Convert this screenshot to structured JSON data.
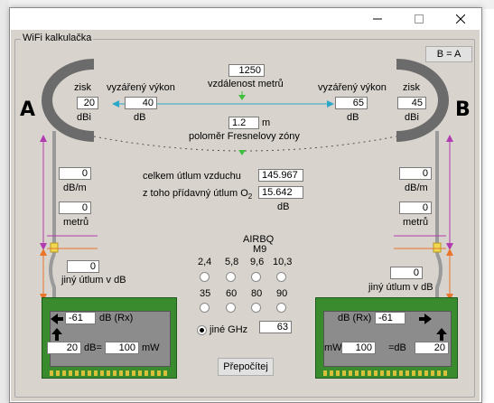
{
  "window": {
    "minimize_icon": "minimize-icon",
    "maximize_icon": "maximize-icon",
    "close_icon": "close-icon"
  },
  "group_title": "WiFi kalkulačka",
  "swap_button": "B = A",
  "left": {
    "letter": "A",
    "gain_label": "zisk",
    "gain_value": "20",
    "gain_unit": "dBi",
    "erp_label": "vyzářený výkon",
    "erp_value": "40",
    "erp_unit": "dB",
    "loss_per_m_value": "0",
    "loss_per_m_unit": "dB/m",
    "meters_value": "0",
    "meters_unit": "metrů",
    "other_loss_value": "0",
    "other_loss_label": "jiný útlum v dB",
    "rx_value": "-61",
    "rx_unit": "dB (Rx)",
    "dbm_value": "20",
    "dbm_eq": "dB=",
    "mw_value": "100",
    "mw_unit": "mW"
  },
  "right": {
    "letter": "B",
    "gain_label": "zisk",
    "gain_value": "45",
    "gain_unit": "dBi",
    "erp_label": "vyzářený výkon",
    "erp_value": "65",
    "erp_unit": "dB",
    "loss_per_m_value": "0",
    "loss_per_m_unit": "dB/m",
    "meters_value": "0",
    "meters_unit": "metrů",
    "other_loss_value": "0",
    "other_loss_label": "jiný útlum v dB",
    "rx_value": "-61",
    "rx_unit": "dB (Rx)",
    "mw_unit": "mW",
    "mw_value": "100",
    "db_eq": "=dB",
    "dbm_value": "20"
  },
  "center": {
    "distance_value": "1250",
    "distance_label": "vzdálenost metrů",
    "fresnel_value": "1.2",
    "fresnel_unit": "m",
    "fresnel_label": "poloměr Fresnelovy zóny",
    "air_loss_label": "celkem  útlum vzduchu",
    "air_loss_value": "145.967",
    "o2_label": "z toho přídavný útlum O",
    "o2_sub": "2",
    "o2_value": "15.642",
    "o2_unit": "dB"
  },
  "freq": {
    "title": "AIRBQ",
    "subtitle": "M9",
    "row1": [
      "2,4",
      "5,8",
      "9,6",
      "10,3"
    ],
    "row2": [
      "35",
      "60",
      "80",
      "90"
    ],
    "other_label": "jiné GHz",
    "other_value": "63",
    "selected": "jiné GHz"
  },
  "recalc_button": "Přepočítej",
  "colors": {
    "window_bg": "#d8d4cd",
    "board_green": "#3a8a2e",
    "arrow_cyan": "#2aa7c9",
    "arrow_magenta": "#b13bb1",
    "arrow_orange": "#e8752a",
    "arrow_green": "#3fbf3f"
  }
}
